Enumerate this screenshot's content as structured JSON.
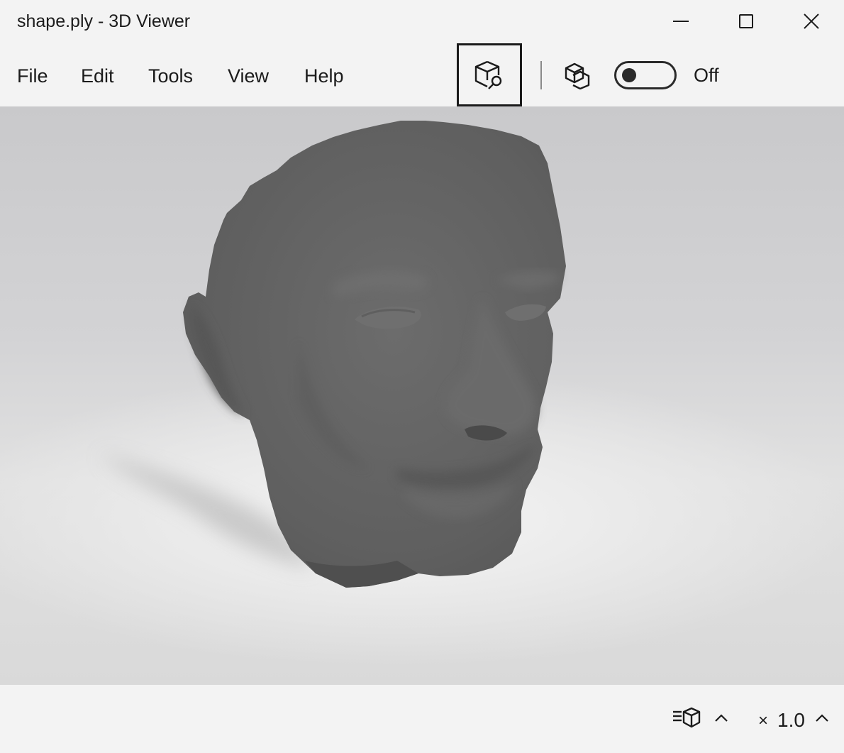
{
  "window": {
    "title": "shape.ply - 3D Viewer",
    "controls": [
      "minimize-icon",
      "maximize-icon",
      "close-icon"
    ]
  },
  "menu": {
    "items": [
      {
        "label": "File"
      },
      {
        "label": "Edit"
      },
      {
        "label": "Tools"
      },
      {
        "label": "View"
      },
      {
        "label": "Help"
      }
    ]
  },
  "toolbar": {
    "inspect_icon": "cube-search-icon",
    "compare_icon": "cube-compare-icon",
    "toggle_state": "Off"
  },
  "viewport": {
    "model": "3d-head-model",
    "model_color": "#626262"
  },
  "status": {
    "view_icon": "cube-list-icon",
    "scale_prefix": "×",
    "scale_value": "1.0"
  }
}
